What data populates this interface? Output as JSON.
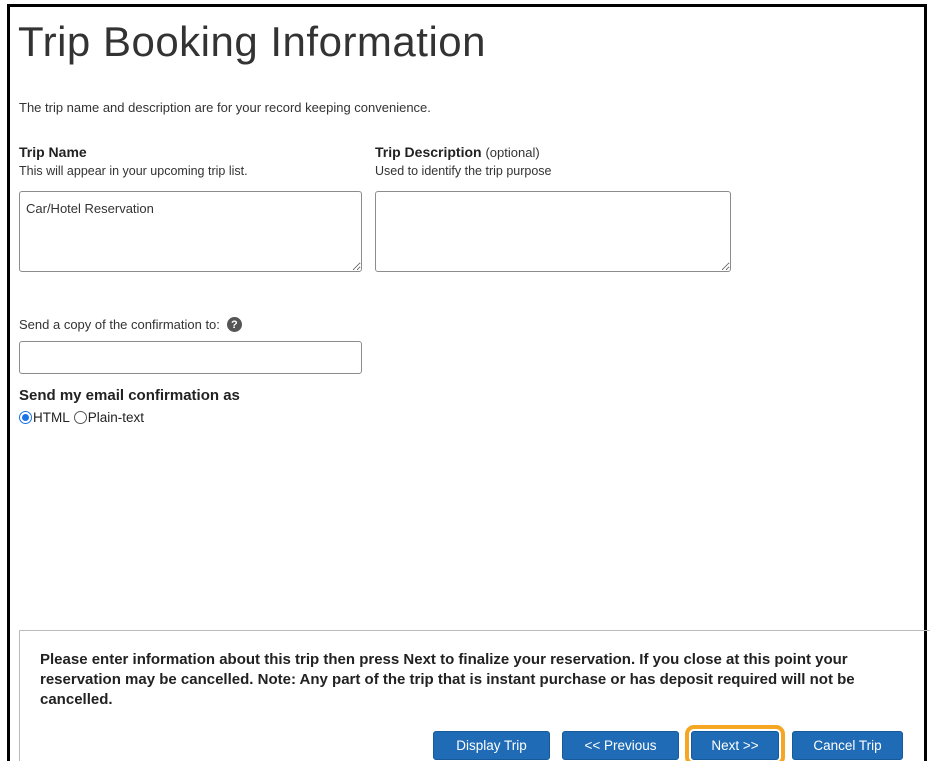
{
  "page": {
    "title": "Trip Booking Information",
    "intro": "The trip name and description are for your record keeping convenience."
  },
  "trip_name": {
    "label": "Trip Name",
    "hint": "This will appear in your upcoming trip list.",
    "value": "Car/Hotel Reservation"
  },
  "trip_description": {
    "label": "Trip Description",
    "optional": "(optional)",
    "hint": "Used to identify the trip purpose",
    "value": ""
  },
  "confirmation_copy": {
    "label": "Send a copy of the confirmation to:",
    "help_icon": "question-circle-icon",
    "value": ""
  },
  "email_format": {
    "label": "Send my email confirmation as",
    "options": [
      {
        "label": "HTML",
        "selected": true
      },
      {
        "label": "Plain-text",
        "selected": false
      }
    ]
  },
  "footer": {
    "message": "Please enter information about this trip then press Next to finalize your reservation. If you close at this point your reservation may be cancelled. Note: Any part of the trip that is instant purchase or has deposit required will not be cancelled."
  },
  "buttons": {
    "display_trip": "Display Trip",
    "previous": "<< Previous",
    "next": "Next >>",
    "cancel_trip": "Cancel Trip"
  },
  "colors": {
    "button_bg": "#1f6bb5",
    "focus_ring": "#f5a623",
    "radio_accent": "#1a73e8"
  }
}
